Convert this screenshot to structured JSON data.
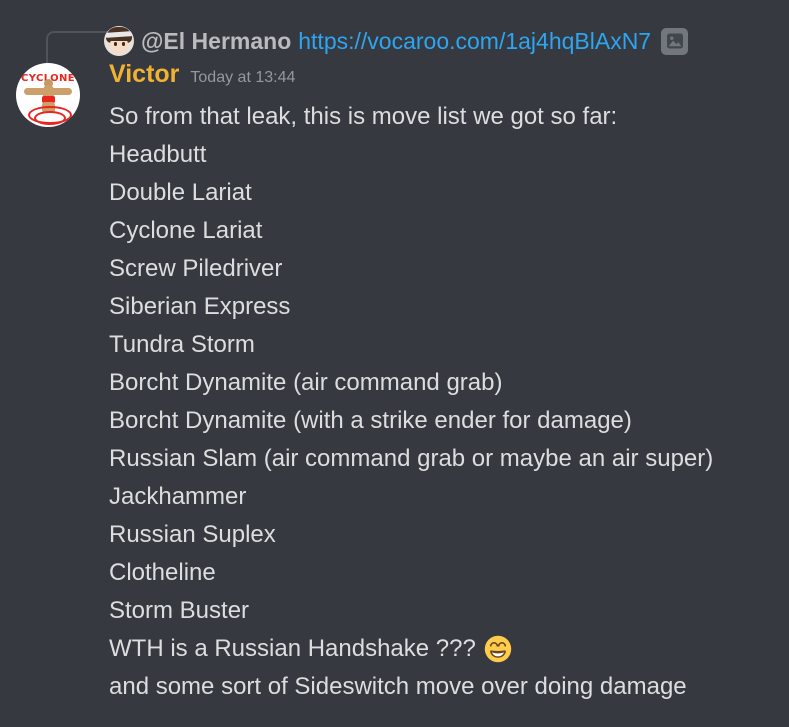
{
  "app": {
    "name": "Discord",
    "background_color": "#36393f"
  },
  "reply_reference": {
    "avatar_icon": "anime-girl-avatar",
    "username": "@El Hermano",
    "link_text": "https://vocaroo.com/1aj4hqBlAxN7",
    "attachment_icon": "image-attachment-icon",
    "username_color": "#b9bbbe",
    "link_color": "#2da6f2"
  },
  "message": {
    "avatar_icon": "cyclone-wrestler-avatar",
    "avatar_logo_text": "CYCLONE",
    "username": "Victor",
    "username_color": "#f0b232",
    "timestamp": "Today at 13:44",
    "lines": [
      {
        "text": "So from that leak, this is move list we got so far:",
        "emoji": null
      },
      {
        "text": "Headbutt",
        "emoji": null
      },
      {
        "text": "Double Lariat",
        "emoji": null
      },
      {
        "text": "Cyclone Lariat",
        "emoji": null
      },
      {
        "text": "Screw Piledriver",
        "emoji": null
      },
      {
        "text": "Siberian Express",
        "emoji": null
      },
      {
        "text": "Tundra Storm",
        "emoji": null
      },
      {
        "text": "Borcht Dynamite (air command grab)",
        "emoji": null
      },
      {
        "text": "Borcht Dynamite (with a strike ender for damage)",
        "emoji": null
      },
      {
        "text": "Russian Slam (air command grab or maybe an air super)",
        "emoji": null
      },
      {
        "text": "Jackhammer",
        "emoji": null
      },
      {
        "text": "Russian Suplex",
        "emoji": null
      },
      {
        "text": "Clotheline",
        "emoji": null
      },
      {
        "text": "Storm Buster",
        "emoji": null
      },
      {
        "text": "WTH is a Russian Handshake ???",
        "emoji": "grinning-face-with-smiling-eyes"
      },
      {
        "text": "and some sort of Sideswitch move over doing damage",
        "emoji": null
      }
    ],
    "text_color": "#dcddde"
  }
}
